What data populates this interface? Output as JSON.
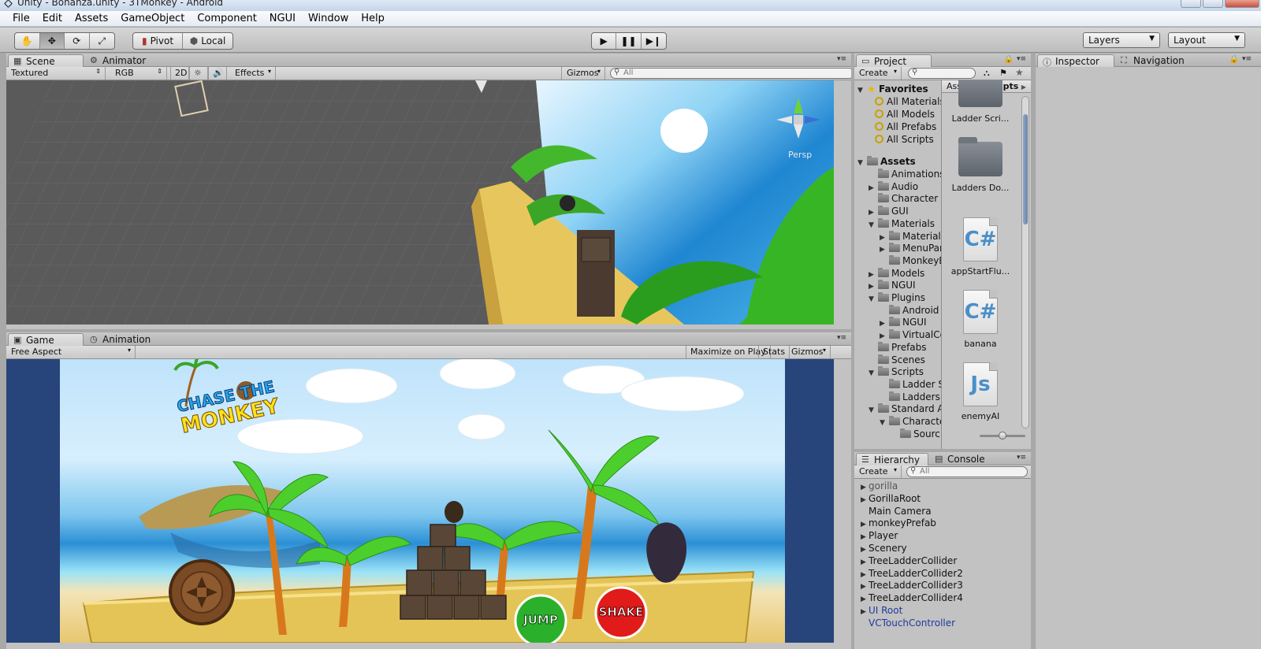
{
  "window": {
    "title": "Unity - Bonanza.unity - 3TMonkey - Android"
  },
  "menu": [
    "File",
    "Edit",
    "Assets",
    "GameObject",
    "Component",
    "NGUI",
    "Window",
    "Help"
  ],
  "toolbar": {
    "pivot_label": "Pivot",
    "local_label": "Local",
    "layers_label": "Layers",
    "layout_label": "Layout"
  },
  "scene": {
    "tabs": [
      "Scene",
      "Animator"
    ],
    "render_mode": "Textured",
    "color_mode": "RGB",
    "mode_2d": "2D",
    "effects_label": "Effects",
    "gizmos_label": "Gizmos",
    "search_placeholder": "All",
    "persp_label": "Persp"
  },
  "game": {
    "tabs": [
      "Game",
      "Animation"
    ],
    "aspect": "Free Aspect",
    "maximize_label": "Maximize on Play",
    "stats_label": "Stats",
    "gizmos_label": "Gizmos",
    "logo_line1": "CHASE THE",
    "logo_line2": "MONKEY",
    "jump_label": "JUMP",
    "shake_label": "SHAKE"
  },
  "project": {
    "tab": "Project",
    "create_label": "Create",
    "breadcrumb": [
      "Assets",
      "Scripts"
    ],
    "favorites_label": "Favorites",
    "favorites": [
      "All Materials",
      "All Models",
      "All Prefabs",
      "All Scripts"
    ],
    "assets_label": "Assets",
    "tree": [
      {
        "label": "Animations",
        "depth": 1,
        "arrow": ""
      },
      {
        "label": "Audio",
        "depth": 1,
        "arrow": "▶"
      },
      {
        "label": "Character C",
        "depth": 1,
        "arrow": ""
      },
      {
        "label": "GUI",
        "depth": 1,
        "arrow": "▶"
      },
      {
        "label": "Materials",
        "depth": 1,
        "arrow": "▼"
      },
      {
        "label": "Materials",
        "depth": 2,
        "arrow": "▶"
      },
      {
        "label": "MenuPar",
        "depth": 2,
        "arrow": "▶"
      },
      {
        "label": "MonkeyB",
        "depth": 2,
        "arrow": ""
      },
      {
        "label": "Models",
        "depth": 1,
        "arrow": "▶"
      },
      {
        "label": "NGUI",
        "depth": 1,
        "arrow": "▶"
      },
      {
        "label": "Plugins",
        "depth": 1,
        "arrow": "▼"
      },
      {
        "label": "Android",
        "depth": 2,
        "arrow": ""
      },
      {
        "label": "NGUI",
        "depth": 2,
        "arrow": "▶"
      },
      {
        "label": "VirtualCo",
        "depth": 2,
        "arrow": "▶"
      },
      {
        "label": "Prefabs",
        "depth": 1,
        "arrow": ""
      },
      {
        "label": "Scenes",
        "depth": 1,
        "arrow": ""
      },
      {
        "label": "Scripts",
        "depth": 1,
        "arrow": "▼"
      },
      {
        "label": "Ladder S",
        "depth": 2,
        "arrow": ""
      },
      {
        "label": "Ladders",
        "depth": 2,
        "arrow": ""
      },
      {
        "label": "Standard A",
        "depth": 1,
        "arrow": "▼"
      },
      {
        "label": "Characte",
        "depth": 2,
        "arrow": "▼"
      },
      {
        "label": "Sourc",
        "depth": 3,
        "arrow": ""
      }
    ],
    "files": [
      {
        "name": "Ladder Scri...",
        "kind": "folder",
        "glyph": ""
      },
      {
        "name": "Ladders Do...",
        "kind": "folder",
        "glyph": ""
      },
      {
        "name": "appStartFlu...",
        "kind": "cs",
        "glyph": "C#"
      },
      {
        "name": "banana",
        "kind": "cs",
        "glyph": "C#"
      },
      {
        "name": "enemyAI",
        "kind": "js",
        "glyph": "Js"
      }
    ]
  },
  "hierarchy": {
    "tab": "Hierarchy",
    "console_tab": "Console",
    "create_label": "Create",
    "search_placeholder": "All",
    "items": [
      {
        "label": "gorilla",
        "arrow": "▶",
        "style": "dim"
      },
      {
        "label": "GorillaRoot",
        "arrow": "▶",
        "style": ""
      },
      {
        "label": "Main Camera",
        "arrow": "",
        "style": ""
      },
      {
        "label": "monkeyPrefab",
        "arrow": "▶",
        "style": ""
      },
      {
        "label": "Player",
        "arrow": "▶",
        "style": ""
      },
      {
        "label": "Scenery",
        "arrow": "▶",
        "style": ""
      },
      {
        "label": "TreeLadderCollider",
        "arrow": "▶",
        "style": ""
      },
      {
        "label": "TreeLadderCollider2",
        "arrow": "▶",
        "style": ""
      },
      {
        "label": "TreeLadderCollider3",
        "arrow": "▶",
        "style": ""
      },
      {
        "label": "TreeLadderCollider4",
        "arrow": "▶",
        "style": ""
      },
      {
        "label": "UI Root",
        "arrow": "▶",
        "style": "prefab"
      },
      {
        "label": "VCTouchController",
        "arrow": "",
        "style": "prefab"
      }
    ]
  },
  "inspector": {
    "tab": "Inspector",
    "navigation_tab": "Navigation"
  }
}
